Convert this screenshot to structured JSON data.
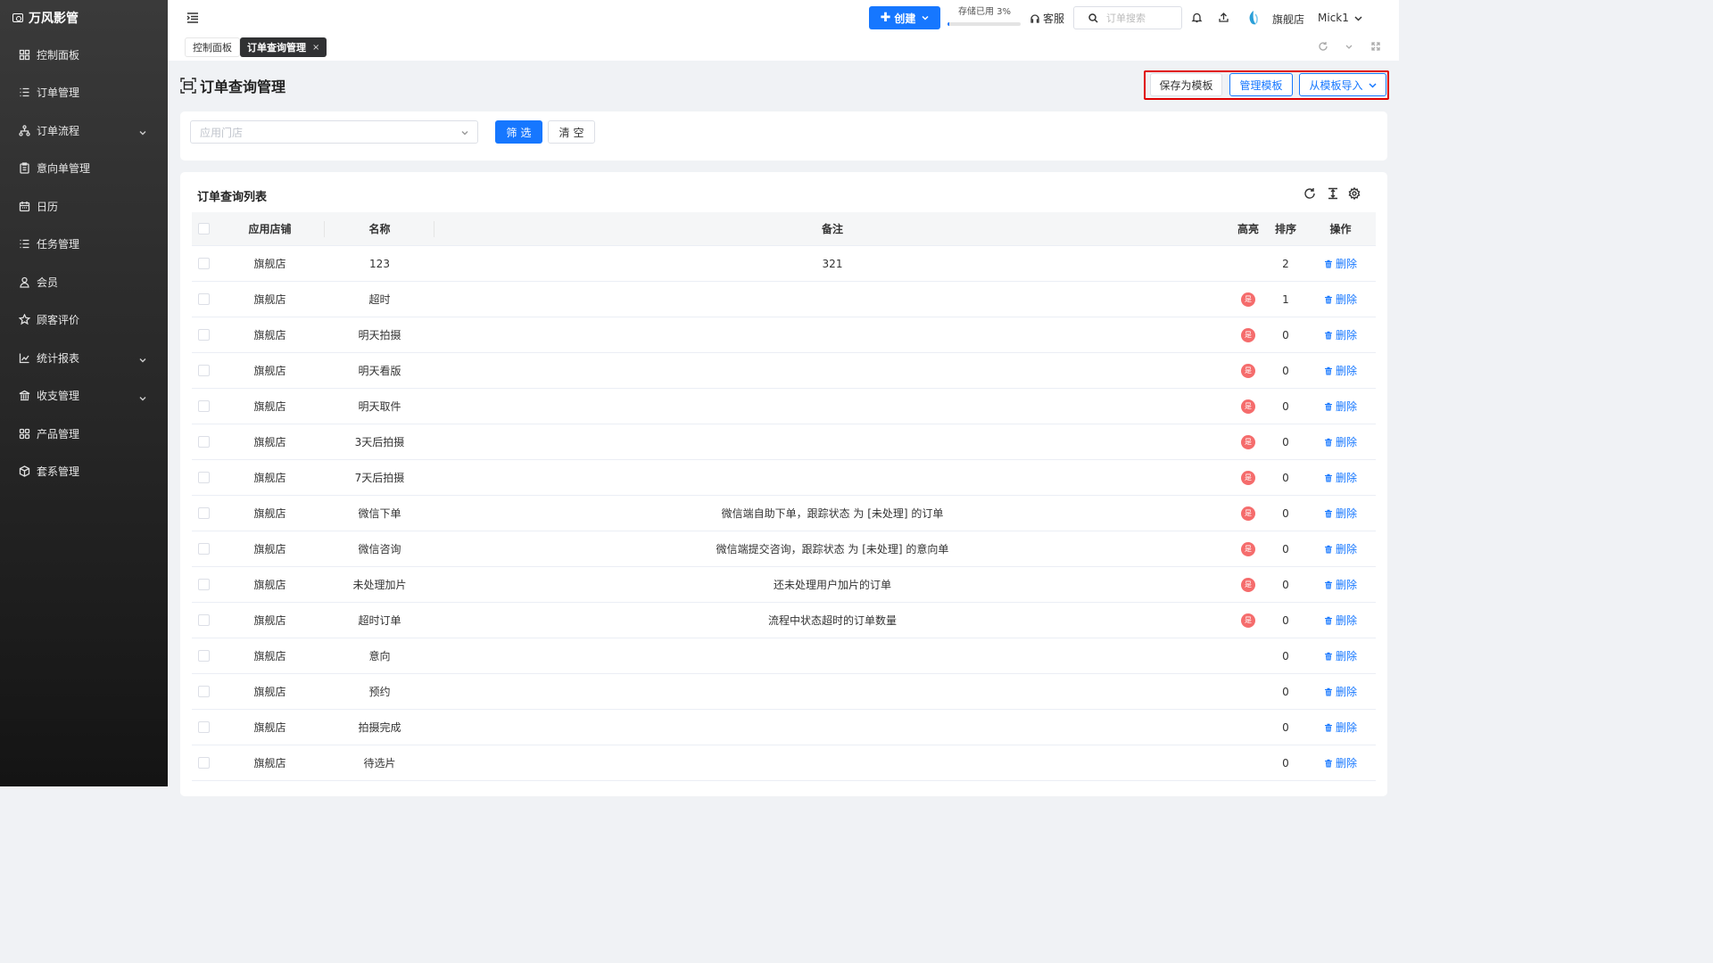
{
  "app": {
    "name": "万风影管"
  },
  "sidebar": {
    "items": [
      {
        "label": "控制面板",
        "icon": "dashboard-icon",
        "expandable": false
      },
      {
        "label": "订单管理",
        "icon": "list-icon",
        "expandable": false
      },
      {
        "label": "订单流程",
        "icon": "flow-icon",
        "expandable": true
      },
      {
        "label": "意向单管理",
        "icon": "clipboard-icon",
        "expandable": false
      },
      {
        "label": "日历",
        "icon": "calendar-icon",
        "expandable": false
      },
      {
        "label": "任务管理",
        "icon": "task-list-icon",
        "expandable": false
      },
      {
        "label": "会员",
        "icon": "user-icon",
        "expandable": false
      },
      {
        "label": "顾客评价",
        "icon": "star-icon",
        "expandable": false
      },
      {
        "label": "统计报表",
        "icon": "line-chart-icon",
        "expandable": true
      },
      {
        "label": "收支管理",
        "icon": "bank-icon",
        "expandable": true
      },
      {
        "label": "产品管理",
        "icon": "grid-icon",
        "expandable": false
      },
      {
        "label": "套系管理",
        "icon": "package-icon",
        "expandable": false
      }
    ]
  },
  "header": {
    "create_label": "创建",
    "storage_label": "存储已用 3%",
    "storage_percent": 3,
    "service_label": "客服",
    "search_placeholder": "订单搜索",
    "store_name": "旗舰店",
    "user_name": "Mick1"
  },
  "tabs": [
    {
      "label": "控制面板",
      "active": false
    },
    {
      "label": "订单查询管理",
      "active": true,
      "close": "×"
    }
  ],
  "page": {
    "title": "订单查询管理",
    "save_template_label": "保存为模板",
    "manage_template_label": "管理模板",
    "import_template_label": "从模板导入"
  },
  "filter": {
    "store_placeholder": "应用门店",
    "filter_label": "筛选",
    "clear_label": "清空"
  },
  "list": {
    "title": "订单查询列表",
    "columns": {
      "store": "应用店铺",
      "name": "名称",
      "note": "备注",
      "highlight": "高亮",
      "sort": "排序",
      "action": "操作"
    },
    "highlight_badge": "是",
    "delete_label": "删除",
    "rows": [
      {
        "store": "旗舰店",
        "name": "123",
        "note": "321",
        "highlight": false,
        "sort": "2"
      },
      {
        "store": "旗舰店",
        "name": "超时",
        "note": "",
        "highlight": true,
        "sort": "1"
      },
      {
        "store": "旗舰店",
        "name": "明天拍摄",
        "note": "",
        "highlight": true,
        "sort": "0"
      },
      {
        "store": "旗舰店",
        "name": "明天看版",
        "note": "",
        "highlight": true,
        "sort": "0"
      },
      {
        "store": "旗舰店",
        "name": "明天取件",
        "note": "",
        "highlight": true,
        "sort": "0"
      },
      {
        "store": "旗舰店",
        "name": "3天后拍摄",
        "note": "",
        "highlight": true,
        "sort": "0"
      },
      {
        "store": "旗舰店",
        "name": "7天后拍摄",
        "note": "",
        "highlight": true,
        "sort": "0"
      },
      {
        "store": "旗舰店",
        "name": "微信下单",
        "note": "微信端自助下单，跟踪状态 为 [未处理] 的订单",
        "highlight": true,
        "sort": "0"
      },
      {
        "store": "旗舰店",
        "name": "微信咨询",
        "note": "微信端提交咨询，跟踪状态 为 [未处理] 的意向单",
        "highlight": true,
        "sort": "0"
      },
      {
        "store": "旗舰店",
        "name": "未处理加片",
        "note": "还未处理用户加片的订单",
        "highlight": true,
        "sort": "0"
      },
      {
        "store": "旗舰店",
        "name": "超时订单",
        "note": "流程中状态超时的订单数量",
        "highlight": true,
        "sort": "0"
      },
      {
        "store": "旗舰店",
        "name": "意向",
        "note": "",
        "highlight": false,
        "sort": "0"
      },
      {
        "store": "旗舰店",
        "name": "预约",
        "note": "",
        "highlight": false,
        "sort": "0"
      },
      {
        "store": "旗舰店",
        "name": "拍摄完成",
        "note": "",
        "highlight": false,
        "sort": "0"
      },
      {
        "store": "旗舰店",
        "name": "待选片",
        "note": "",
        "highlight": false,
        "sort": "0"
      }
    ]
  }
}
